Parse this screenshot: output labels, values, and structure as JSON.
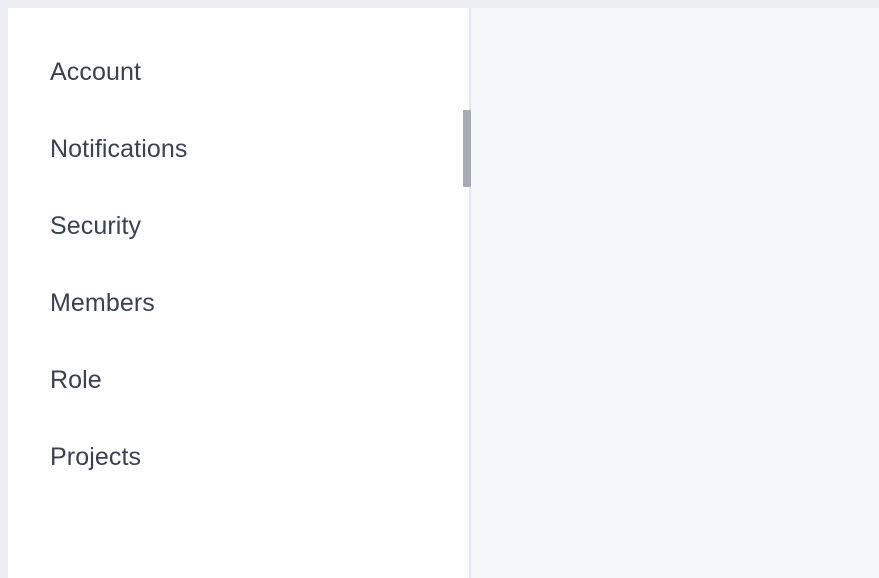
{
  "sidebar": {
    "items": [
      {
        "label": "Account"
      },
      {
        "label": "Notifications"
      },
      {
        "label": "Security"
      },
      {
        "label": "Members"
      },
      {
        "label": "Role"
      },
      {
        "label": "Projects"
      }
    ]
  },
  "colors": {
    "page_background": "#ebedf2",
    "sidebar_background": "#ffffff",
    "content_background": "#f5f6fa",
    "text": "#3a4150",
    "active_indicator": "#a6abb5"
  }
}
